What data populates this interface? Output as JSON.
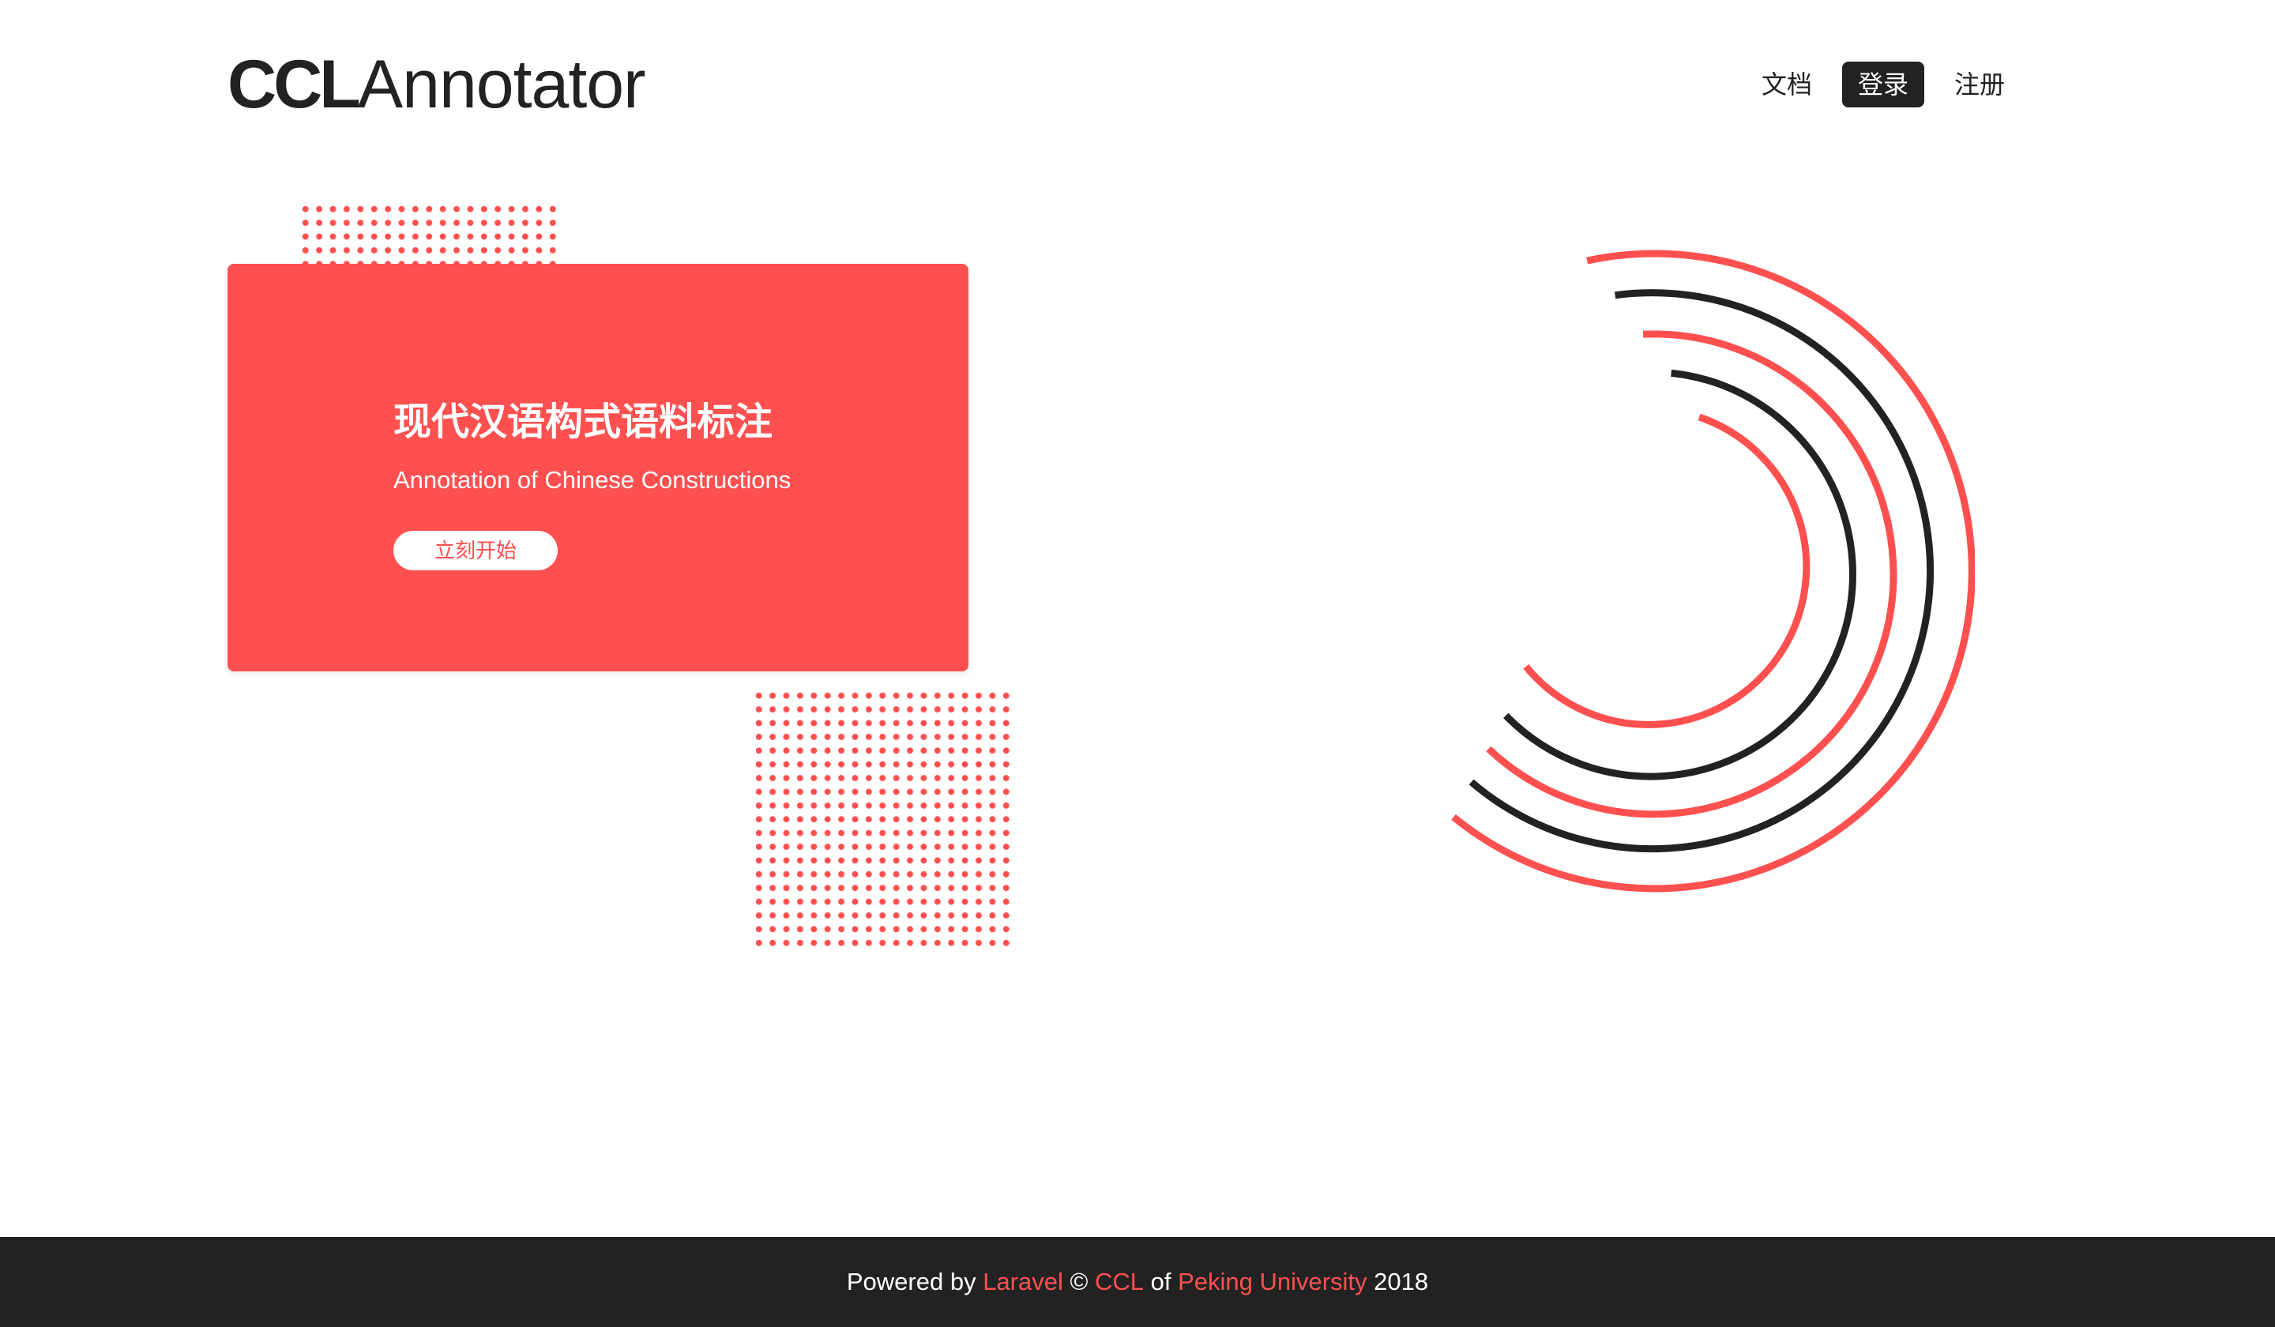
{
  "brand": {
    "bold": "CCL",
    "light": "Annotator"
  },
  "nav": {
    "docs": "文档",
    "login": "登录",
    "register": "注册"
  },
  "hero": {
    "title": "现代汉语构式语料标注",
    "subtitle": "Annotation of Chinese Constructions",
    "button": "立刻开始"
  },
  "footer": {
    "powered_by": "Powered by ",
    "laravel": "Laravel",
    "copyright": " © ",
    "ccl": "CCL",
    "of": " of ",
    "university": "Peking University",
    "year": " 2018"
  },
  "colors": {
    "accent": "#ff5050",
    "dark": "#222222",
    "background": "#ffffff"
  }
}
